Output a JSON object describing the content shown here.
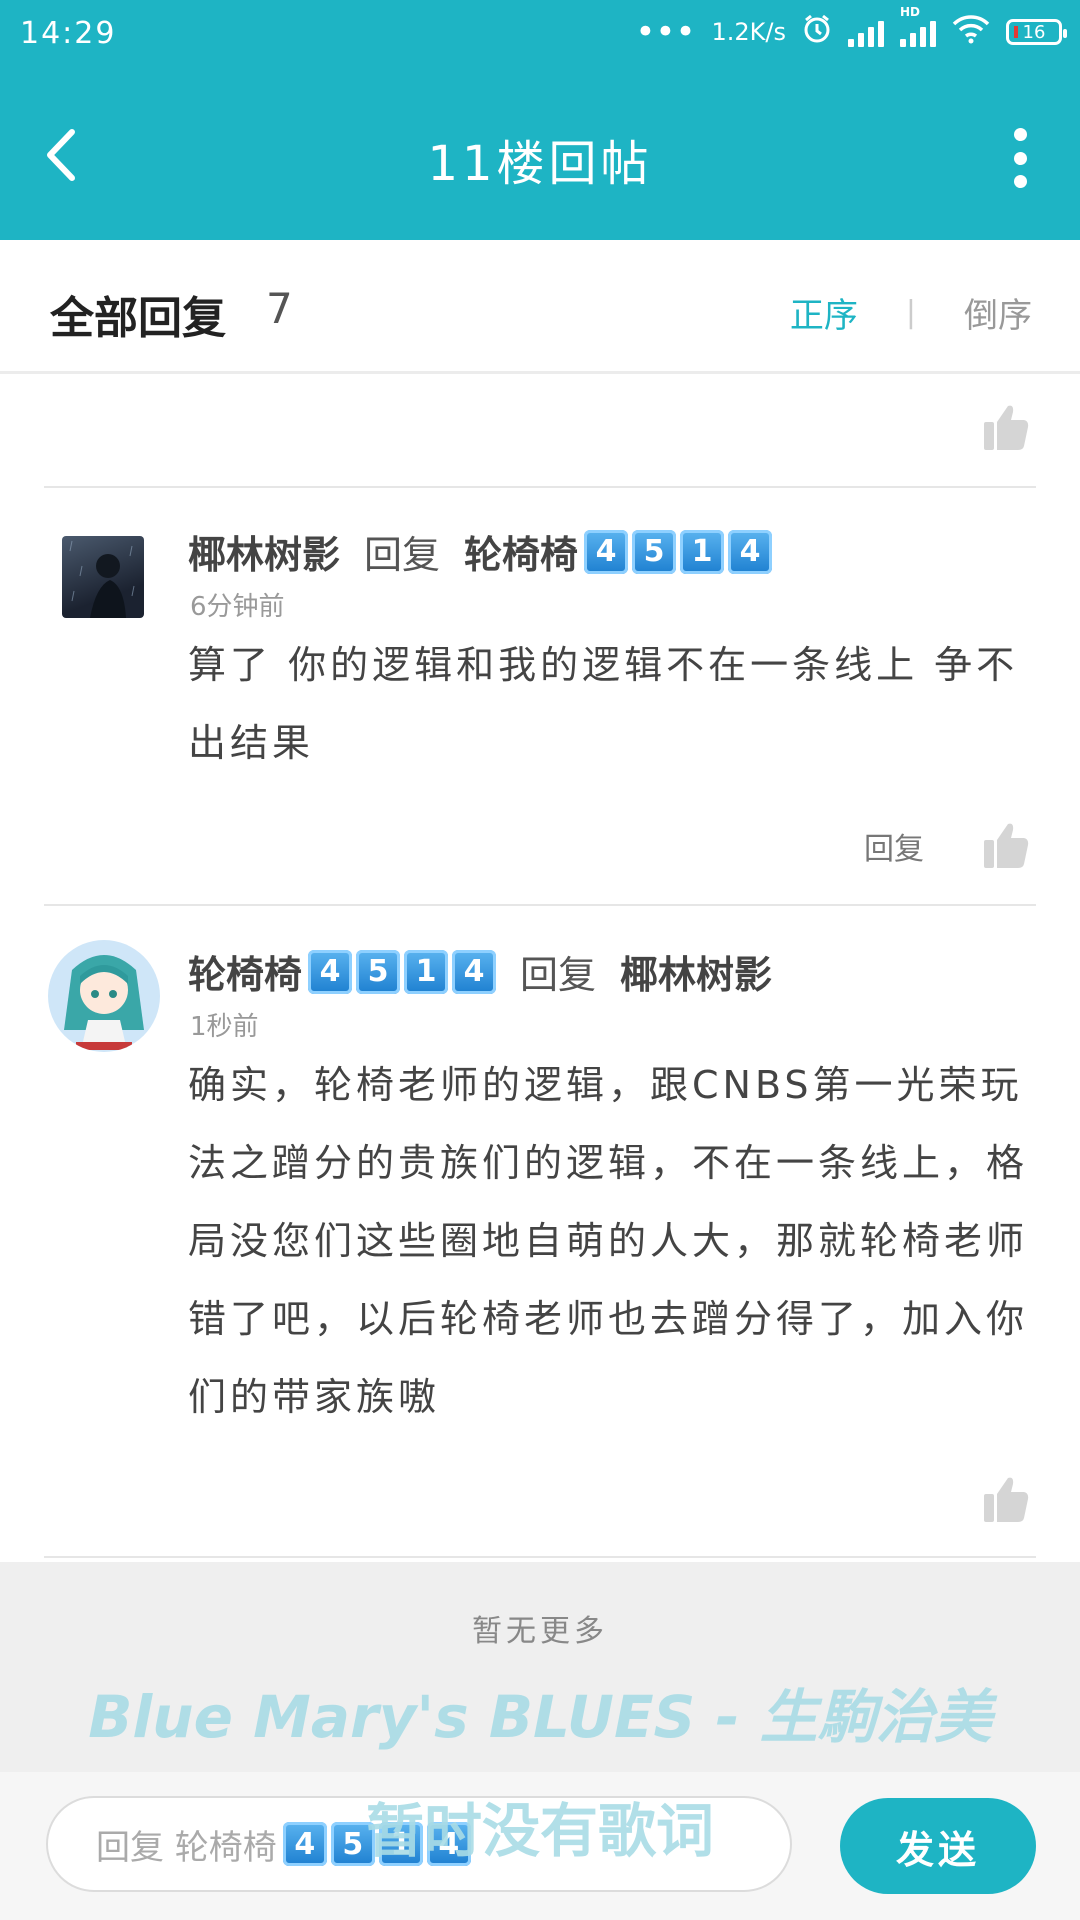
{
  "status_bar": {
    "time": "14:29",
    "speed": "1.2K/s",
    "hd_label": "HD",
    "battery": "16"
  },
  "titlebar": {
    "title": "11楼回帖"
  },
  "replies_header": {
    "label": "全部回复",
    "count": "7",
    "sort_asc": "正序",
    "sort_sep": "|",
    "sort_desc": "倒序"
  },
  "replies": [
    {
      "author": "椰林树影",
      "verb": "回复",
      "target": "轮椅椅",
      "target_badge": [
        "4",
        "5",
        "1",
        "4"
      ],
      "time": "6分钟前",
      "text": "算了 你的逻辑和我的逻辑不在一条线上 争不出结果",
      "reply_label": "回复"
    },
    {
      "author": "轮椅椅",
      "author_badge": [
        "4",
        "5",
        "1",
        "4"
      ],
      "verb": "回复",
      "target": "椰林树影",
      "time": "1秒前",
      "text": "确实，轮椅老师的逻辑，跟CNBS第一光荣玩法之蹭分的贵族们的逻辑，不在一条线上，格局没您们这些圈地自萌的人大，那就轮椅老师错了吧，以后轮椅老师也去蹭分得了，加入你们的带家族嗷"
    }
  ],
  "no_more": "暂无更多",
  "watermark": {
    "line1": "Blue Mary's BLUES - 生駒治美",
    "line2": "暂时没有歌词"
  },
  "reply_box": {
    "placeholder_prefix": "回复 轮椅椅",
    "placeholder_badge": [
      "4",
      "5",
      "1",
      "4"
    ],
    "send_label": "发送"
  },
  "colors": {
    "accent": "#1eb4c4",
    "keycap": "#2a8fe0",
    "watermark": "#a9dce6"
  }
}
